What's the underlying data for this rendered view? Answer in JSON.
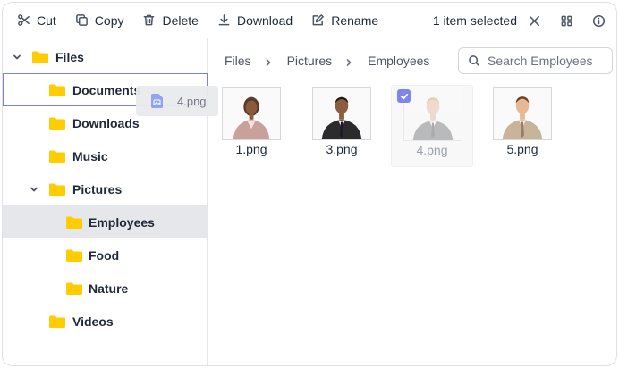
{
  "toolbar": {
    "cut_label": "Cut",
    "copy_label": "Copy",
    "delete_label": "Delete",
    "download_label": "Download",
    "rename_label": "Rename",
    "selection_text": "1 item selected"
  },
  "tree": {
    "root": "Files",
    "items": [
      "Documents",
      "Downloads",
      "Music",
      "Pictures",
      "Employees",
      "Food",
      "Nature",
      "Videos"
    ]
  },
  "drag": {
    "file_name": "4.png"
  },
  "breadcrumb": [
    "Files",
    "Pictures",
    "Employees"
  ],
  "search": {
    "placeholder": "Search Employees"
  },
  "files": [
    {
      "name": "1.png",
      "selected": false
    },
    {
      "name": "3.png",
      "selected": false
    },
    {
      "name": "4.png",
      "selected": true
    },
    {
      "name": "5.png",
      "selected": false
    }
  ],
  "colors": {
    "folder": "#ffcc00",
    "accent": "#7f86e8",
    "selected_row": "#e6e7ea"
  }
}
